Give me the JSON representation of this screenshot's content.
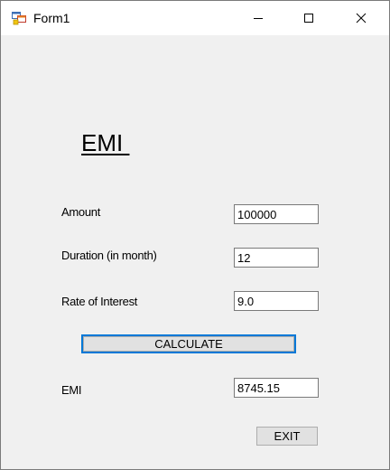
{
  "window": {
    "title": "Form1"
  },
  "form": {
    "heading": "EMI ",
    "fields": {
      "amount": {
        "label": "Amount",
        "value": "100000"
      },
      "duration": {
        "label": "Duration (in month)",
        "value": "12"
      },
      "rate": {
        "label": "Rate of Interest",
        "value": "9.0"
      },
      "emi": {
        "label": "EMI",
        "value": "8745.15"
      }
    },
    "buttons": {
      "calculate": "CALCULATE",
      "exit": "EXIT"
    }
  },
  "colors": {
    "focus_border": "#0078d7",
    "button_face": "#e1e1e1",
    "form_background": "#f0f0f0"
  }
}
